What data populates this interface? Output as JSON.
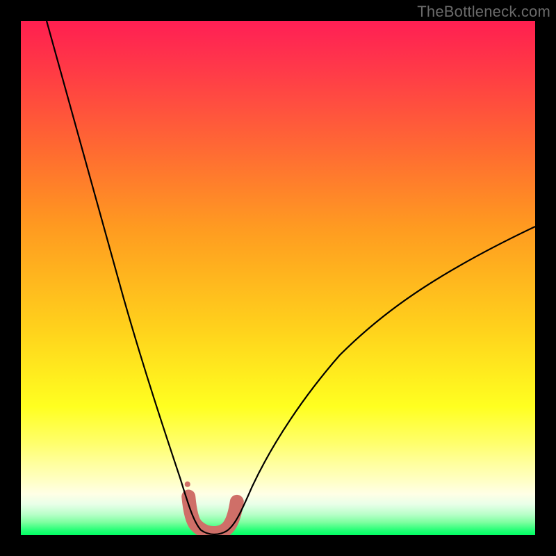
{
  "watermark": "TheBottleneck.com",
  "chart_data": {
    "type": "line",
    "title": "",
    "xlabel": "",
    "ylabel": "",
    "xlim": [
      0,
      100
    ],
    "ylim": [
      0,
      100
    ],
    "grid": false,
    "legend": false,
    "description": "Bottleneck-style V-curve over a vertical rainbow gradient (red high, green low). Curve value = bottleneck % vs. component balance. Minimum ~0% around x≈34–41; left branch rises to 100% at x≈5; right branch rises to ~60% at x=100.",
    "series": [
      {
        "name": "bottleneck_curve",
        "x": [
          5,
          8,
          12,
          16,
          20,
          24,
          28,
          31,
          33,
          34,
          36,
          38,
          40,
          41,
          43,
          46,
          50,
          55,
          60,
          66,
          72,
          80,
          90,
          100
        ],
        "y": [
          100,
          88,
          73,
          59,
          46,
          33,
          21,
          11,
          5,
          2,
          0.5,
          0.3,
          0.6,
          2,
          5,
          10,
          16,
          23,
          29,
          36,
          42,
          48,
          54,
          60
        ]
      }
    ],
    "highlight_band": {
      "name": "optimal_range_marker_style",
      "color": "#cf6f68",
      "x_range": [
        32.5,
        42
      ],
      "stroke_width_px": 20
    },
    "background_gradient_stops": [
      {
        "pos": 0,
        "color": "#ff1f4a"
      },
      {
        "pos": 60,
        "color": "#ffd21c"
      },
      {
        "pos": 92,
        "color": "#ffffe6"
      },
      {
        "pos": 100,
        "color": "#00ff63"
      }
    ]
  }
}
